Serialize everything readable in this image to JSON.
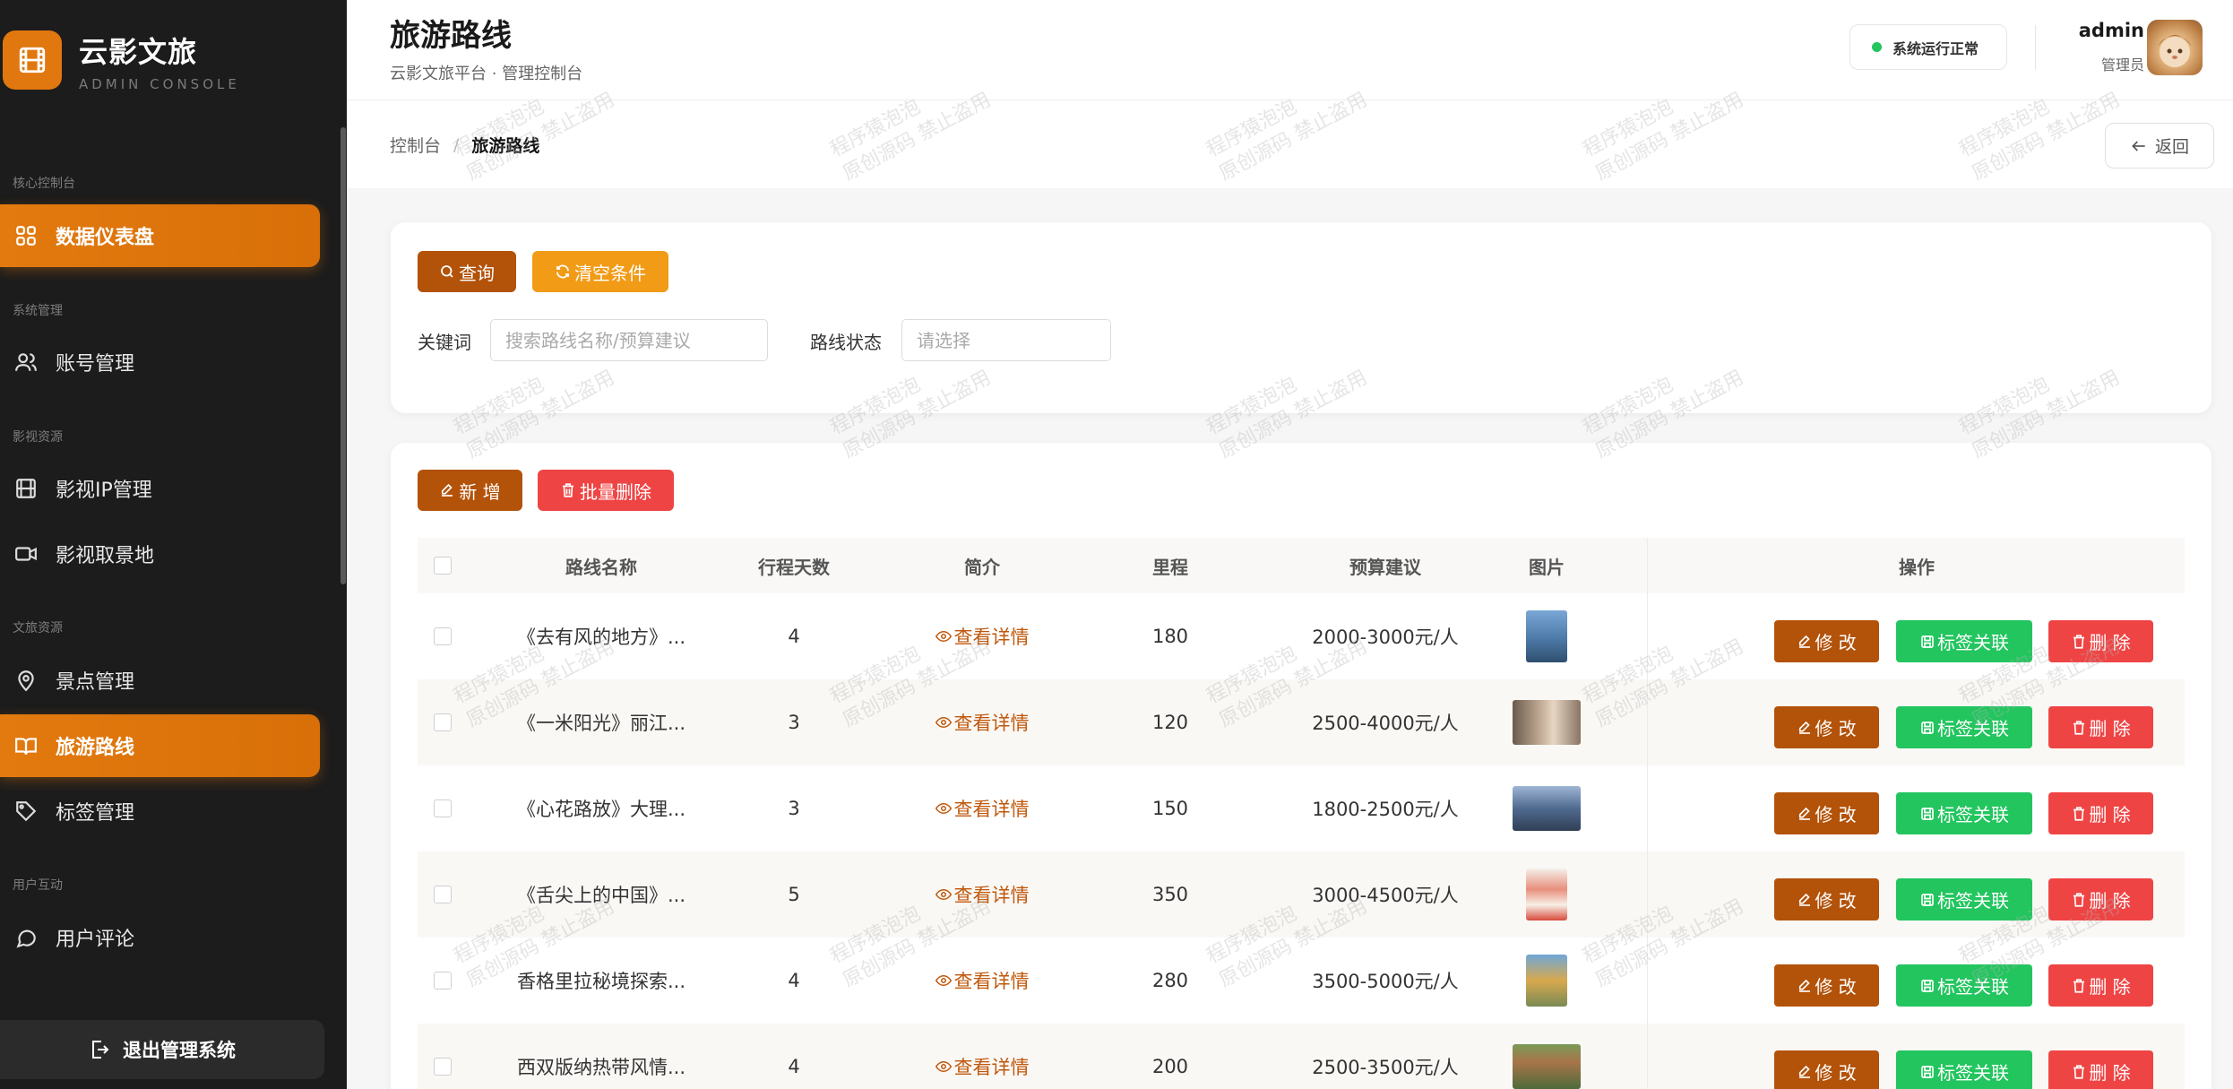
{
  "brand": {
    "title": "云影文旅",
    "subtitle": "ADMIN CONSOLE"
  },
  "sidebar": {
    "groups": [
      {
        "label": "核心控制台"
      },
      {
        "label": "系统管理"
      },
      {
        "label": "影视资源"
      },
      {
        "label": "文旅资源"
      },
      {
        "label": "用户互动"
      }
    ],
    "items": [
      {
        "label": "数据仪表盘",
        "icon": "dashboard-icon",
        "active": true
      },
      {
        "label": "账号管理",
        "icon": "users-icon"
      },
      {
        "label": "影视IP管理",
        "icon": "film-icon"
      },
      {
        "label": "影视取景地",
        "icon": "video-icon"
      },
      {
        "label": "景点管理",
        "icon": "location-icon"
      },
      {
        "label": "旅游路线",
        "icon": "book-icon",
        "active": true
      },
      {
        "label": "标签管理",
        "icon": "tag-icon"
      },
      {
        "label": "用户评论",
        "icon": "comment-icon"
      }
    ],
    "logout": "退出管理系统"
  },
  "header": {
    "title": "旅游路线",
    "subtitle": "云影文旅平台 · 管理控制台",
    "status": "系统运行正常",
    "user_name": "admin",
    "user_role": "管理员"
  },
  "breadcrumb": {
    "home": "控制台",
    "separator": "/",
    "current": "旅游路线",
    "back": "返回"
  },
  "search": {
    "query_btn": "查询",
    "clear_btn": "清空条件",
    "keyword_label": "关键词",
    "keyword_placeholder": "搜索路线名称/预算建议",
    "status_label": "路线状态",
    "status_placeholder": "请选择"
  },
  "toolbar": {
    "add_btn": "新 增",
    "batch_delete_btn": "批量删除"
  },
  "table": {
    "columns": [
      "路线名称",
      "行程天数",
      "简介",
      "里程",
      "预算建议",
      "图片",
      "操作"
    ],
    "detail_link": "查看详情",
    "actions": {
      "edit": "修 改",
      "tag": "标签关联",
      "delete": "删 除"
    },
    "rows": [
      {
        "name": "《去有风的地方》...",
        "days": "4",
        "mileage": "180",
        "budget": "2000-3000元/人"
      },
      {
        "name": "《一米阳光》丽江...",
        "days": "3",
        "mileage": "120",
        "budget": "2500-4000元/人"
      },
      {
        "name": "《心花路放》大理...",
        "days": "3",
        "mileage": "150",
        "budget": "1800-2500元/人"
      },
      {
        "name": "《舌尖上的中国》...",
        "days": "5",
        "mileage": "350",
        "budget": "3000-4500元/人"
      },
      {
        "name": "香格里拉秘境探索...",
        "days": "4",
        "mileage": "280",
        "budget": "3500-5000元/人"
      },
      {
        "name": "西双版纳热带风情...",
        "days": "4",
        "mileage": "200",
        "budget": "2500-3500元/人"
      }
    ]
  },
  "watermark": {
    "line1": "程序猿泡泡",
    "line2": "原创源码 禁止盗用"
  },
  "colors": {
    "accent": "#e0780f",
    "brown": "#b35209",
    "orange": "#f19b17",
    "red": "#ef4444",
    "green": "#22c55e",
    "sidebar": "#1c1c1c"
  }
}
